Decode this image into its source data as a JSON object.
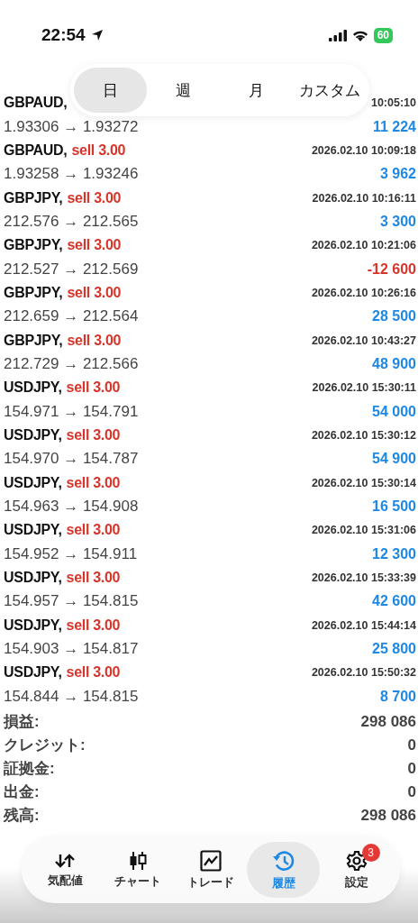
{
  "status_bar": {
    "time": "22:54",
    "battery": "60"
  },
  "period_tabs": [
    {
      "label": "日",
      "selected": true
    },
    {
      "label": "週",
      "selected": false
    },
    {
      "label": "月",
      "selected": false
    },
    {
      "label": "カスタム",
      "selected": false
    }
  ],
  "trades": [
    {
      "symbol": "GBPAUD,",
      "time": "10:05:10",
      "prices": "1.93306 → 1.93272",
      "profit": "11 224",
      "loss": false
    },
    {
      "symbol": "GBPAUD,",
      "side": "sell 3.00",
      "time": "2026.02.10 10:09:18",
      "prices": "1.93258 → 1.93246",
      "profit": "3 962",
      "loss": false
    },
    {
      "symbol": "GBPJPY,",
      "side": "sell 3.00",
      "time": "2026.02.10 10:16:11",
      "prices": "212.576 → 212.565",
      "profit": "3 300",
      "loss": false
    },
    {
      "symbol": "GBPJPY,",
      "side": "sell 3.00",
      "time": "2026.02.10 10:21:06",
      "prices": "212.527 → 212.569",
      "profit": "-12 600",
      "loss": true
    },
    {
      "symbol": "GBPJPY,",
      "side": "sell 3.00",
      "time": "2026.02.10 10:26:16",
      "prices": "212.659 → 212.564",
      "profit": "28 500",
      "loss": false
    },
    {
      "symbol": "GBPJPY,",
      "side": "sell 3.00",
      "time": "2026.02.10 10:43:27",
      "prices": "212.729 → 212.566",
      "profit": "48 900",
      "loss": false
    },
    {
      "symbol": "USDJPY,",
      "side": "sell 3.00",
      "time": "2026.02.10 15:30:11",
      "prices": "154.971 → 154.791",
      "profit": "54 000",
      "loss": false
    },
    {
      "symbol": "USDJPY,",
      "side": "sell 3.00",
      "time": "2026.02.10 15:30:12",
      "prices": "154.970 → 154.787",
      "profit": "54 900",
      "loss": false
    },
    {
      "symbol": "USDJPY,",
      "side": "sell 3.00",
      "time": "2026.02.10 15:30:14",
      "prices": "154.963 → 154.908",
      "profit": "16 500",
      "loss": false
    },
    {
      "symbol": "USDJPY,",
      "side": "sell 3.00",
      "time": "2026.02.10 15:31:06",
      "prices": "154.952 → 154.911",
      "profit": "12 300",
      "loss": false
    },
    {
      "symbol": "USDJPY,",
      "side": "sell 3.00",
      "time": "2026.02.10 15:33:39",
      "prices": "154.957 → 154.815",
      "profit": "42 600",
      "loss": false
    },
    {
      "symbol": "USDJPY,",
      "side": "sell 3.00",
      "time": "2026.02.10 15:44:14",
      "prices": "154.903 → 154.817",
      "profit": "25 800",
      "loss": false
    },
    {
      "symbol": "USDJPY,",
      "side": "sell 3.00",
      "time": "2026.02.10 15:50:32",
      "prices": "154.844 → 154.815",
      "profit": "8 700",
      "loss": false
    }
  ],
  "totals": [
    {
      "label": "損益:",
      "value": "298 086"
    },
    {
      "label": "クレジット:",
      "value": "0"
    },
    {
      "label": "証拠金:",
      "value": "0"
    },
    {
      "label": "出金:",
      "value": "0"
    },
    {
      "label": "残高:",
      "value": "298 086"
    }
  ],
  "nav": [
    {
      "kind": "quotes",
      "label": "気配値",
      "selected": false
    },
    {
      "kind": "chart",
      "label": "チャート",
      "selected": false
    },
    {
      "kind": "trade",
      "label": "トレード",
      "selected": false
    },
    {
      "kind": "history",
      "label": "履歴",
      "selected": true
    },
    {
      "kind": "settings",
      "label": "設定",
      "selected": false,
      "badge": "3"
    }
  ]
}
